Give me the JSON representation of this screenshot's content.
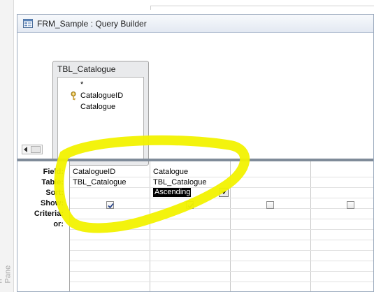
{
  "side_pane": {
    "label": "n Pane"
  },
  "window": {
    "title": "FRM_Sample : Query Builder"
  },
  "table_box": {
    "name": "TBL_Catalogue",
    "fields": [
      {
        "label": "*",
        "key": false
      },
      {
        "label": "CatalogueID",
        "key": true
      },
      {
        "label": "Catalogue",
        "key": false
      }
    ]
  },
  "grid": {
    "row_labels": [
      "Field:",
      "Table:",
      "Sort:",
      "Show:",
      "Criteria:",
      "or:"
    ],
    "columns": [
      {
        "field": "CatalogueID",
        "table": "TBL_Catalogue",
        "sort": "",
        "show": true
      },
      {
        "field": "Catalogue",
        "table": "TBL_Catalogue",
        "sort": "Ascending",
        "show": true
      },
      {
        "field": "",
        "table": "",
        "sort": "",
        "show": false
      },
      {
        "field": "",
        "table": "",
        "sort": "",
        "show": false
      }
    ]
  },
  "colors": {
    "highlight": "#f2f200",
    "splitter": "#7f8b99",
    "title_bar": "#e3e9f2"
  },
  "icons": {
    "form": "form-icon",
    "key": "primary-key-icon",
    "dropdown": "chevron-down-icon",
    "check": "check-icon",
    "scroll_left": "arrow-left-icon"
  }
}
